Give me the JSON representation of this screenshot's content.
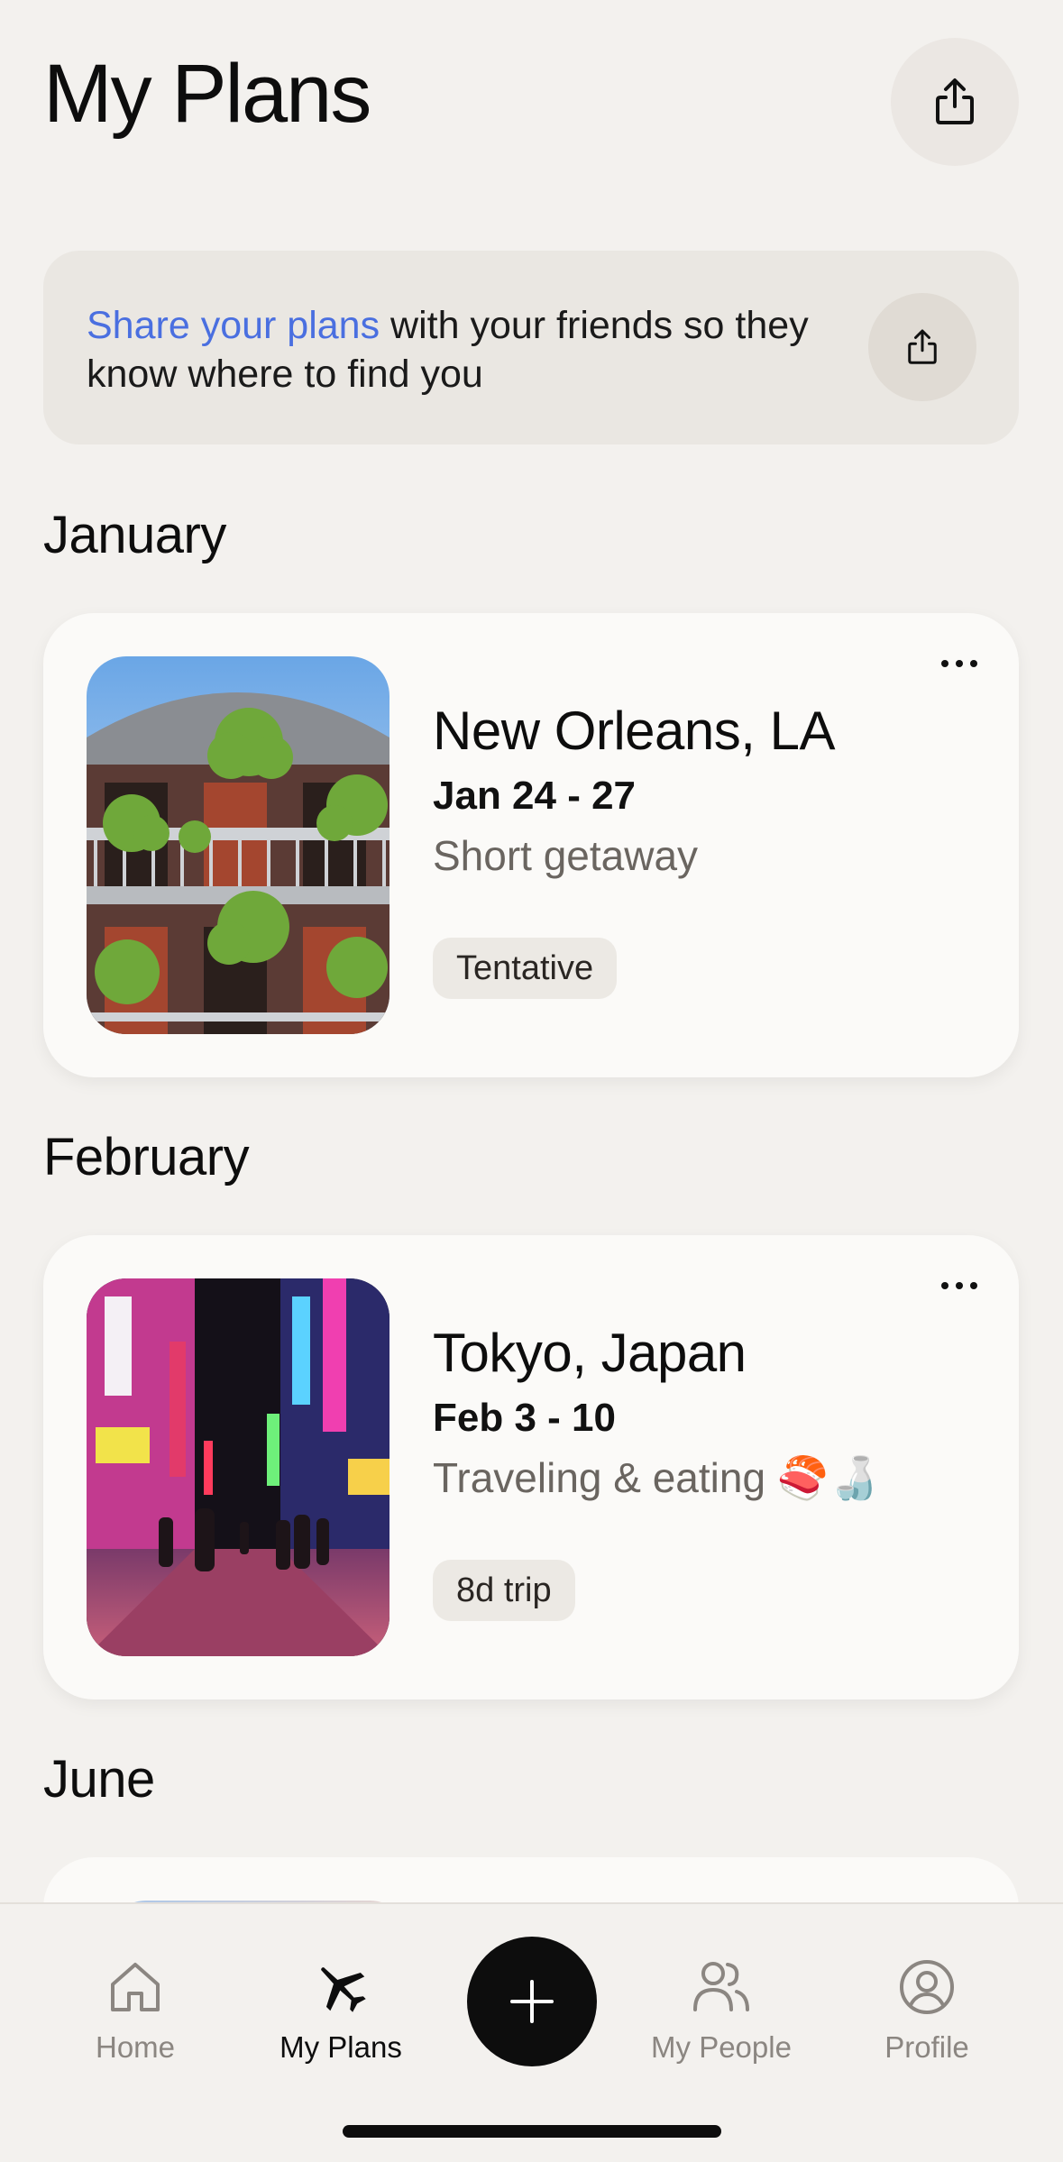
{
  "header": {
    "title": "My Plans",
    "share_icon": "share-icon"
  },
  "banner": {
    "highlight": "Share your plans",
    "text": " with your friends so they know where to find you",
    "share_icon": "share-icon"
  },
  "sections": [
    {
      "month": "January",
      "plan": {
        "title": "New Orleans, LA",
        "dates": "Jan 24 - 27",
        "description": "Short getaway",
        "tag": "Tentative",
        "image": "french-quarter-balcony-photo"
      }
    },
    {
      "month": "February",
      "plan": {
        "title": "Tokyo, Japan",
        "dates": "Feb 3 - 10",
        "description": "Traveling & eating 🍣🍶",
        "tag": "8d trip",
        "image": "tokyo-neon-street-photo"
      }
    },
    {
      "month": "June"
    }
  ],
  "tabbar": {
    "tabs": [
      {
        "label": "Home",
        "icon": "home-icon",
        "active": false
      },
      {
        "label": "My Plans",
        "icon": "airplane-icon",
        "active": true
      },
      {
        "label": "My People",
        "icon": "people-icon",
        "active": false
      },
      {
        "label": "Profile",
        "icon": "profile-icon",
        "active": false
      }
    ],
    "add_icon": "plus-icon"
  },
  "colors": {
    "background": "#f3f1ee",
    "accent": "#4a6fe0",
    "card": "#fbfaf8",
    "chip": "#ece9e4"
  }
}
